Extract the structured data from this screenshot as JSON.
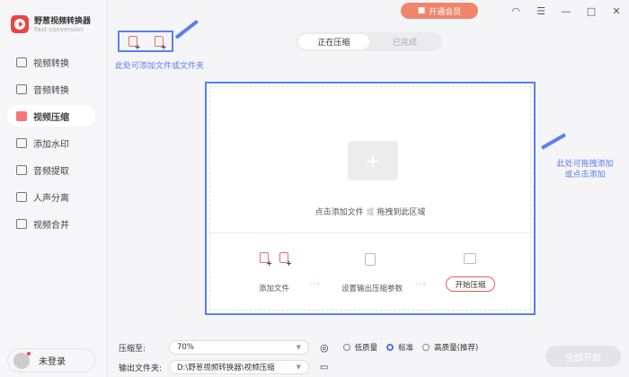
{
  "app": {
    "name": "野葱视频转换器",
    "subtitle": "Fast conversion"
  },
  "topbar": {
    "vip_label": "开通会员"
  },
  "sidebar": {
    "items": [
      {
        "label": "视频转换"
      },
      {
        "label": "音频转换"
      },
      {
        "label": "视频压缩",
        "active": true
      },
      {
        "label": "添加水印"
      },
      {
        "label": "音频提取"
      },
      {
        "label": "人声分离"
      },
      {
        "label": "视频合并"
      }
    ],
    "user": "未登录"
  },
  "hints": {
    "add": "此处可添加文件或文件夹",
    "drag_line1": "此处可拖拽添加",
    "drag_line2": "或点击添加"
  },
  "tabs": [
    {
      "label": "正在压缩",
      "active": true
    },
    {
      "label": "已完成"
    }
  ],
  "drop": {
    "text_a": "点击添加文件",
    "text_or": "或",
    "text_b": "拖拽到此区域"
  },
  "steps": {
    "add": "添加文件",
    "set": "设置输出压缩参数",
    "start": "开始压缩"
  },
  "settings": {
    "compress_label": "压缩至:",
    "compress_value": "70%",
    "output_label": "输出文件夹:",
    "output_value": "D:\\野葱视频转换器\\视频压缩",
    "quality": [
      {
        "label": "低质量",
        "selected": false
      },
      {
        "label": "标准",
        "selected": true
      },
      {
        "label": "高质量(推荐)",
        "selected": false
      }
    ]
  },
  "start_all": "全部开始",
  "colors": {
    "accent": "#e8474a",
    "annotation": "#5b7ff0"
  }
}
